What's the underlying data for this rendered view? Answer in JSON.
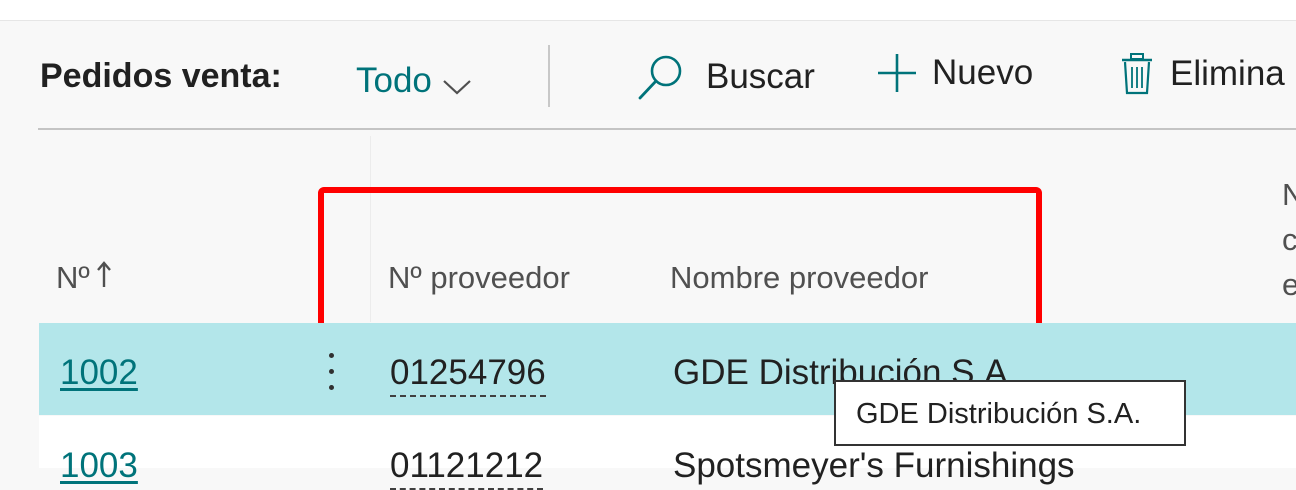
{
  "toolbar": {
    "title": "Pedidos venta:",
    "filter_label": "Todo",
    "search_label": "Buscar",
    "new_label": "Nuevo",
    "delete_label": "Elimina"
  },
  "columns": {
    "no": "Nº",
    "vendor_no": "Nº proveedor",
    "vendor_name": "Nombre proveedor",
    "next_col_partial": "N\nc\ne"
  },
  "rows": [
    {
      "no": "1002",
      "vendor_no": "01254796",
      "vendor_name": "GDE Distribución S.A."
    },
    {
      "no": "1003",
      "vendor_no": "01121212",
      "vendor_name": "Spotsmeyer's Furnishings"
    }
  ],
  "tooltip": "GDE Distribución S.A.",
  "colors": {
    "accent": "#00737a",
    "selected_row": "#b3e6ea",
    "annotation_box": "#ff0000"
  },
  "icons": [
    "chevron-down-icon",
    "search-icon",
    "plus-icon",
    "trash-icon",
    "sort-ascending-icon",
    "more-options-icon"
  ]
}
